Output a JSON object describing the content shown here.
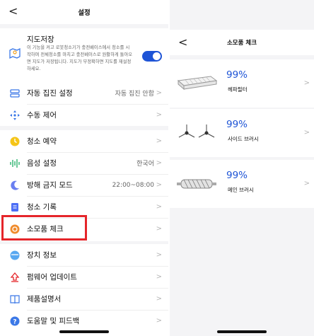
{
  "left": {
    "back_glyph": "<",
    "title": "설정",
    "map_save": {
      "title": "지도저장",
      "description": "이 기능을 켜고 로봇청소기가 충전베이스에서 청소를 시작하며 전체청소를 마치고 충전베이스로 원활하게 돌아오면 지도가 저장됩니다. 지도가 부정확하면 지도를 재설정하세요."
    },
    "auto_collect": {
      "label": "자동 집진 설정",
      "value": "자동 집진 안함"
    },
    "manual_control": {
      "label": "수동 제어"
    },
    "schedule": {
      "label": "청소 예약"
    },
    "voice": {
      "label": "음성 설정",
      "value": "한국어"
    },
    "dnd": {
      "label": "방해 금지 모드",
      "value": "22:00~08:00"
    },
    "history": {
      "label": "청소 기록"
    },
    "consumables": {
      "label": "소모품 체크"
    },
    "device_info": {
      "label": "장치 정보"
    },
    "firmware": {
      "label": "펌웨어 업데이트"
    },
    "manual": {
      "label": "제품설명서"
    },
    "help": {
      "label": "도움말 및 피드백"
    },
    "chevron": ">"
  },
  "right": {
    "back_glyph": "<",
    "title": "소모품 체크",
    "items": [
      {
        "percent": "99%",
        "name": "헤파필터",
        "icon": "hepa-filter-image"
      },
      {
        "percent": "99%",
        "name": "사이드 브러시",
        "icon": "side-brush-image"
      },
      {
        "percent": "99%",
        "name": "메인 브러시",
        "icon": "main-brush-image"
      }
    ],
    "chevron": ">"
  },
  "colors": {
    "accent": "#1e54d6",
    "highlight_border": "#e5252a",
    "background": "#f4f4f6"
  }
}
